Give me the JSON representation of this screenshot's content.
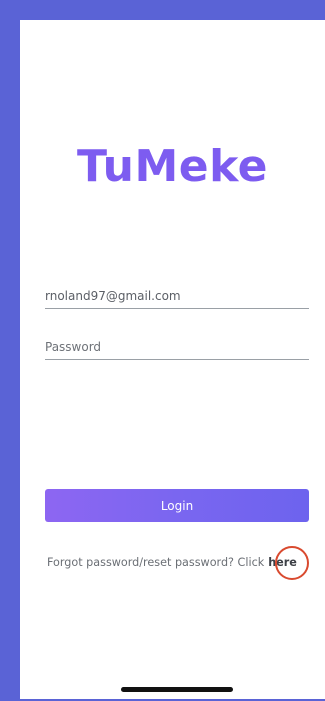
{
  "app": {
    "logo_text": "TuMeke"
  },
  "login_form": {
    "email_value": "rnoland97@gmail.com",
    "password_placeholder": "Password",
    "login_label": "Login",
    "forgot_text": "Forgot password/reset password? Click",
    "forgot_link_label": "here"
  },
  "colors": {
    "frame_background": "#5a63d6",
    "logo": "#7d5cf0",
    "button_gradient_start": "#8d66f2",
    "button_gradient_end": "#6d63ee",
    "annotation_circle": "#d94a2f"
  }
}
